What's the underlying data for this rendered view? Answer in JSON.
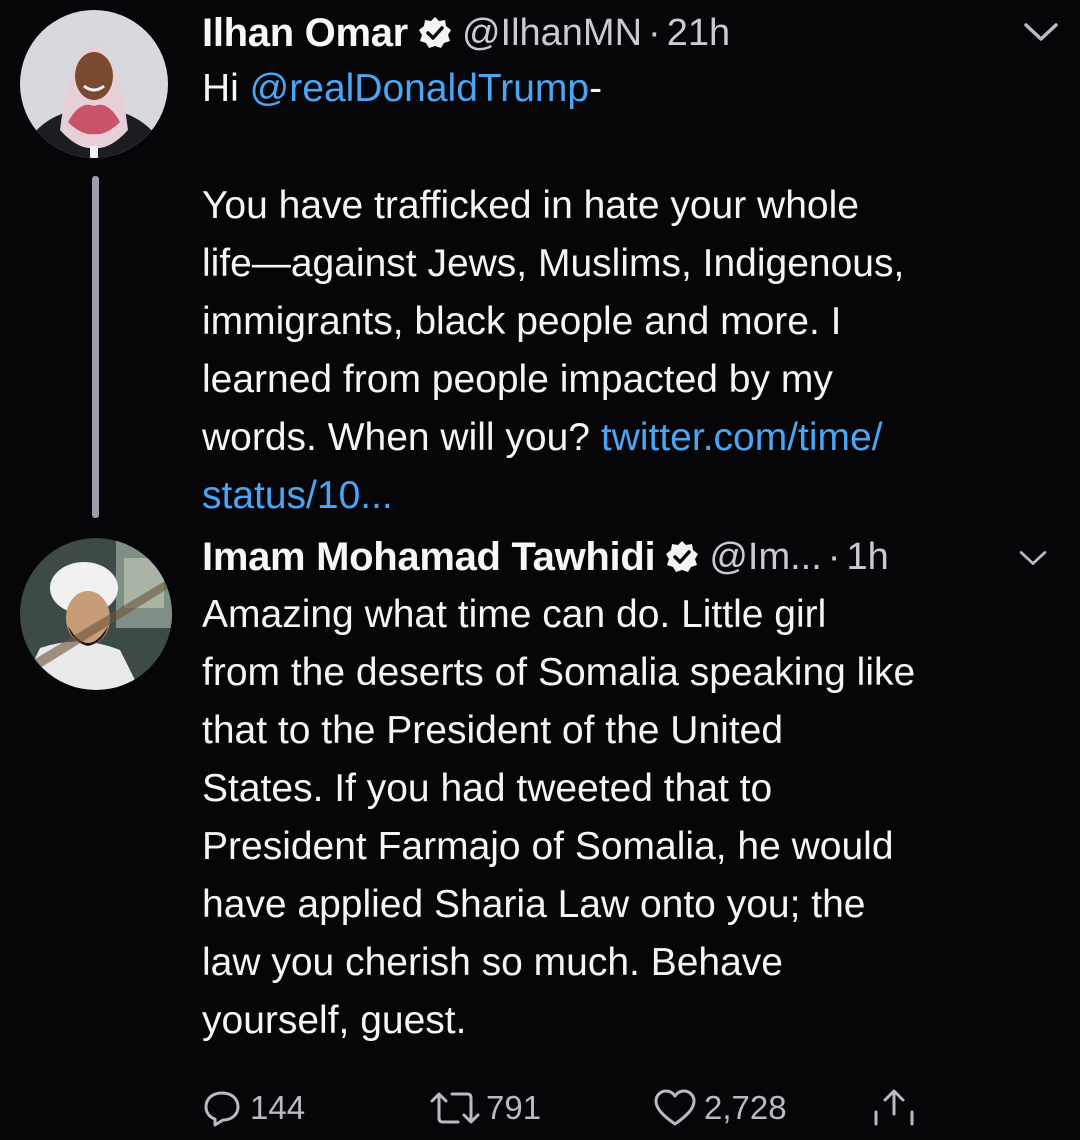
{
  "tweet1": {
    "name": "Ilhan Omar",
    "handle": "@IlhanMN",
    "separator": "·",
    "time": "21h",
    "greeting": "Hi ",
    "mention": "@realDonaldTrump",
    "greeting_suffix": "-",
    "body": "You have trafficked in hate your whole\nlife—against Jews, Muslims, Indigenous,\nimmigrants, black people and more. I\nlearned from people impacted by my\nwords. When will you? ",
    "link_line1": "twitter.com/time/",
    "link_line2": "status/10..."
  },
  "tweet2": {
    "name": "Imam Mohamad Tawhidi",
    "handle": "@Im...",
    "separator": "·",
    "time": "1h",
    "body": "Amazing what time can do. Little girl\nfrom the deserts of Somalia speaking like\nthat to the President of the United\nStates. If you had tweeted that to\nPresident Farmajo of Somalia, he would\nhave applied Sharia Law onto you; the\nlaw you cherish so much. Behave\nyourself, guest."
  },
  "actions": {
    "replies": "144",
    "retweets": "791",
    "likes": "2,728"
  },
  "icons": {
    "verified": "verified-badge-icon",
    "menu": "chevron-down-icon",
    "reply": "reply-icon",
    "retweet": "retweet-icon",
    "like": "heart-icon",
    "share": "share-icon"
  },
  "colors": {
    "background": "#060609",
    "link": "#4ba5f5",
    "text": "#f5f5f7",
    "muted": "#c9cad2"
  }
}
